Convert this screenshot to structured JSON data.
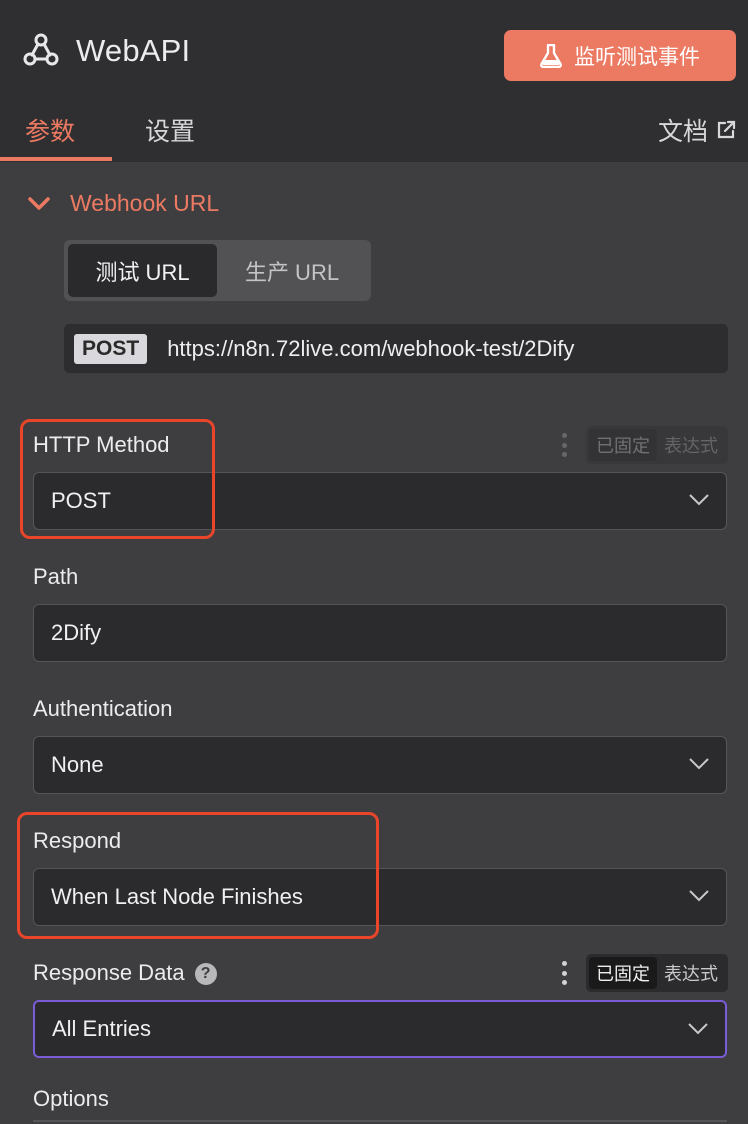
{
  "header": {
    "title": "WebAPI",
    "icon": "webhook-icon",
    "listen_button": "监听测试事件",
    "tabs": [
      {
        "label": "参数",
        "active": true
      },
      {
        "label": "设置",
        "active": false
      }
    ],
    "docs_label": "文档"
  },
  "webhook_url": {
    "section_label": "Webhook URL",
    "toggle": [
      {
        "label": "测试 URL",
        "active": true
      },
      {
        "label": "生产 URL",
        "active": false
      }
    ],
    "method": "POST",
    "url": "https://n8n.72live.com/webhook-test/2Dify"
  },
  "fields": {
    "http_method": {
      "label": "HTTP Method",
      "value": "POST",
      "pinned_label": "已固定",
      "expression_label": "表达式"
    },
    "path": {
      "label": "Path",
      "value": "2Dify"
    },
    "authentication": {
      "label": "Authentication",
      "value": "None"
    },
    "respond": {
      "label": "Respond",
      "value": "When Last Node Finishes"
    },
    "response_data": {
      "label": "Response Data",
      "help": "?",
      "value": "All Entries",
      "pinned_label": "已固定",
      "expression_label": "表达式"
    },
    "options": {
      "label": "Options"
    }
  },
  "colors": {
    "accent": "#ec7a62",
    "highlight_box": "#e8452a",
    "focus_border": "#7a5cd6",
    "background": "#3e3e41",
    "header_bg": "#2f2f31"
  }
}
